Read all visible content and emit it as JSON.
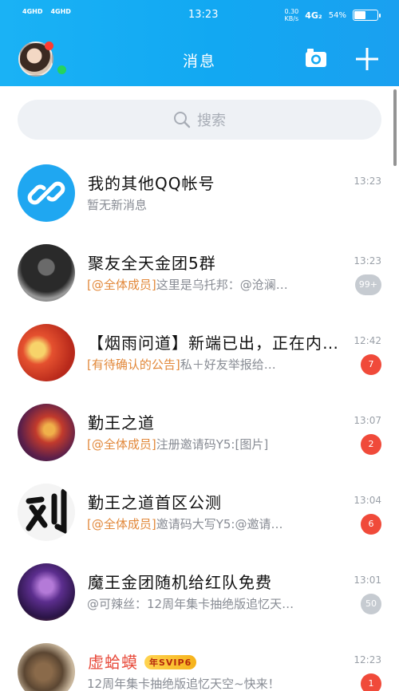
{
  "status_bar": {
    "network_1": "4GHD",
    "network_2": "4GHD",
    "time": "13:23",
    "speed_value": "0.30",
    "speed_unit": "KB/s",
    "net_type": "4G₂",
    "battery": "54%"
  },
  "header": {
    "title": "消息"
  },
  "search": {
    "placeholder": "搜索"
  },
  "conversations": [
    {
      "name": "我的其他QQ帐号",
      "tag": "",
      "preview": "暂无新消息",
      "time": "13:23",
      "badge": ""
    },
    {
      "name": "聚友全天金团5群",
      "tag": "[@全体成员]",
      "preview": "这里是乌托邦：@沧澜…",
      "time": "13:23",
      "badge": "99+"
    },
    {
      "name": "【烟雨问道】新端已出，正在内…",
      "tag": "[有待确认的公告]",
      "preview": "私＋好友举报给…",
      "time": "12:42",
      "badge": "7"
    },
    {
      "name": "勤王之道",
      "tag": "[@全体成员]",
      "preview": "注册邀请码Y5:[图片]",
      "time": "13:07",
      "badge": "2"
    },
    {
      "name": "勤王之道首区公测",
      "tag": "[@全体成员]",
      "preview": "邀请码大写Y5:@邀请…",
      "time": "13:04",
      "badge": "6"
    },
    {
      "name": "魔王金团随机给红队免费",
      "tag": "",
      "preview": "@可辣丝：12周年集卡抽绝版追忆天…",
      "time": "13:01",
      "badge": "50"
    },
    {
      "name": "虚蛤蟆",
      "tag": "",
      "preview": "12周年集卡抽绝版追忆天空~快来！",
      "time": "12:23",
      "badge": "1",
      "vip_label": "年SVIP6"
    }
  ],
  "colors": {
    "header": "#12a8f2",
    "badge_red": "#f04a3a",
    "badge_grey": "#c6cbd1",
    "tag_orange": "#e2883a"
  }
}
